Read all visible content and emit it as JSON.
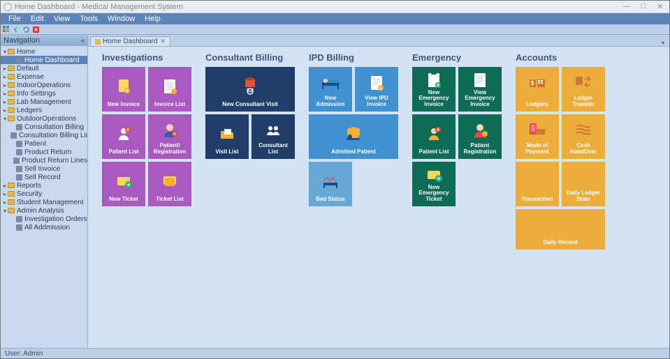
{
  "window": {
    "title": "Home Dashboard - Medical Management System",
    "minimize": "—",
    "maximize": "□",
    "close": "✕"
  },
  "menu": {
    "items": [
      "File",
      "Edit",
      "View",
      "Tools",
      "Window",
      "Help"
    ]
  },
  "nav": {
    "header": "Navigation",
    "pin": "«",
    "tree": {
      "home": "Home",
      "home_dashboard": "Home Dashboard",
      "default": "Default",
      "expense": "Expense",
      "indoor": "IndoorOperations",
      "info": "Info Settings",
      "lab": "Lab Management",
      "ledgers": "Ledgers",
      "outdoor": "OutdoorOperations",
      "out_cb": "Consultation Billing",
      "out_cbl": "Consultation Billing Lines",
      "out_pat": "Patient",
      "out_pr": "Product Return",
      "out_prl": "Product Return Lines",
      "out_si": "Sell Invoice",
      "out_sr": "Sell Record",
      "reports": "Reports",
      "security": "Security",
      "student": "Student Management",
      "admin": "Admin Analysis",
      "admin_io": "Investigation Orders",
      "admin_aa": "All Addmission"
    }
  },
  "tab": {
    "label": "Home Dashboard",
    "close": "✕"
  },
  "dashboard": {
    "investigations": {
      "title": "Investigations",
      "tiles": [
        "New Invoice",
        "Invoice List",
        "Patient List",
        "Patient\\ Registration",
        "New Ticket",
        "Ticket List"
      ]
    },
    "consultant": {
      "title": "Consultant Billing",
      "tiles": [
        "New Consultant Visit",
        "Visit List",
        "Consultant List"
      ]
    },
    "ipd": {
      "title": "IPD Billing",
      "tiles": [
        "New Admission",
        "View IPD Invoice",
        "Admitted Patient",
        "Bed Status"
      ]
    },
    "emergency": {
      "title": "Emergency",
      "tiles": [
        "New Emergency Invoice",
        "View Emergency Invoice",
        "Patient List",
        "Patient Registration",
        "New Emergency Ticket"
      ]
    },
    "accounts": {
      "title": "Accounts",
      "tiles": [
        "Ledgers",
        "Ledger Transfer",
        "Mode of Payment",
        "Cash HandOver",
        "Transaction",
        "Daily Ledger State",
        "Daily Record"
      ]
    }
  },
  "status": {
    "user": "User: Admin"
  },
  "colors": {
    "purple": "#a85ac0",
    "navy": "#1f3d66",
    "blue": "#3f92cf",
    "lblue": "#66a9d5",
    "green": "#0e6b56",
    "orange": "#edad3a"
  }
}
